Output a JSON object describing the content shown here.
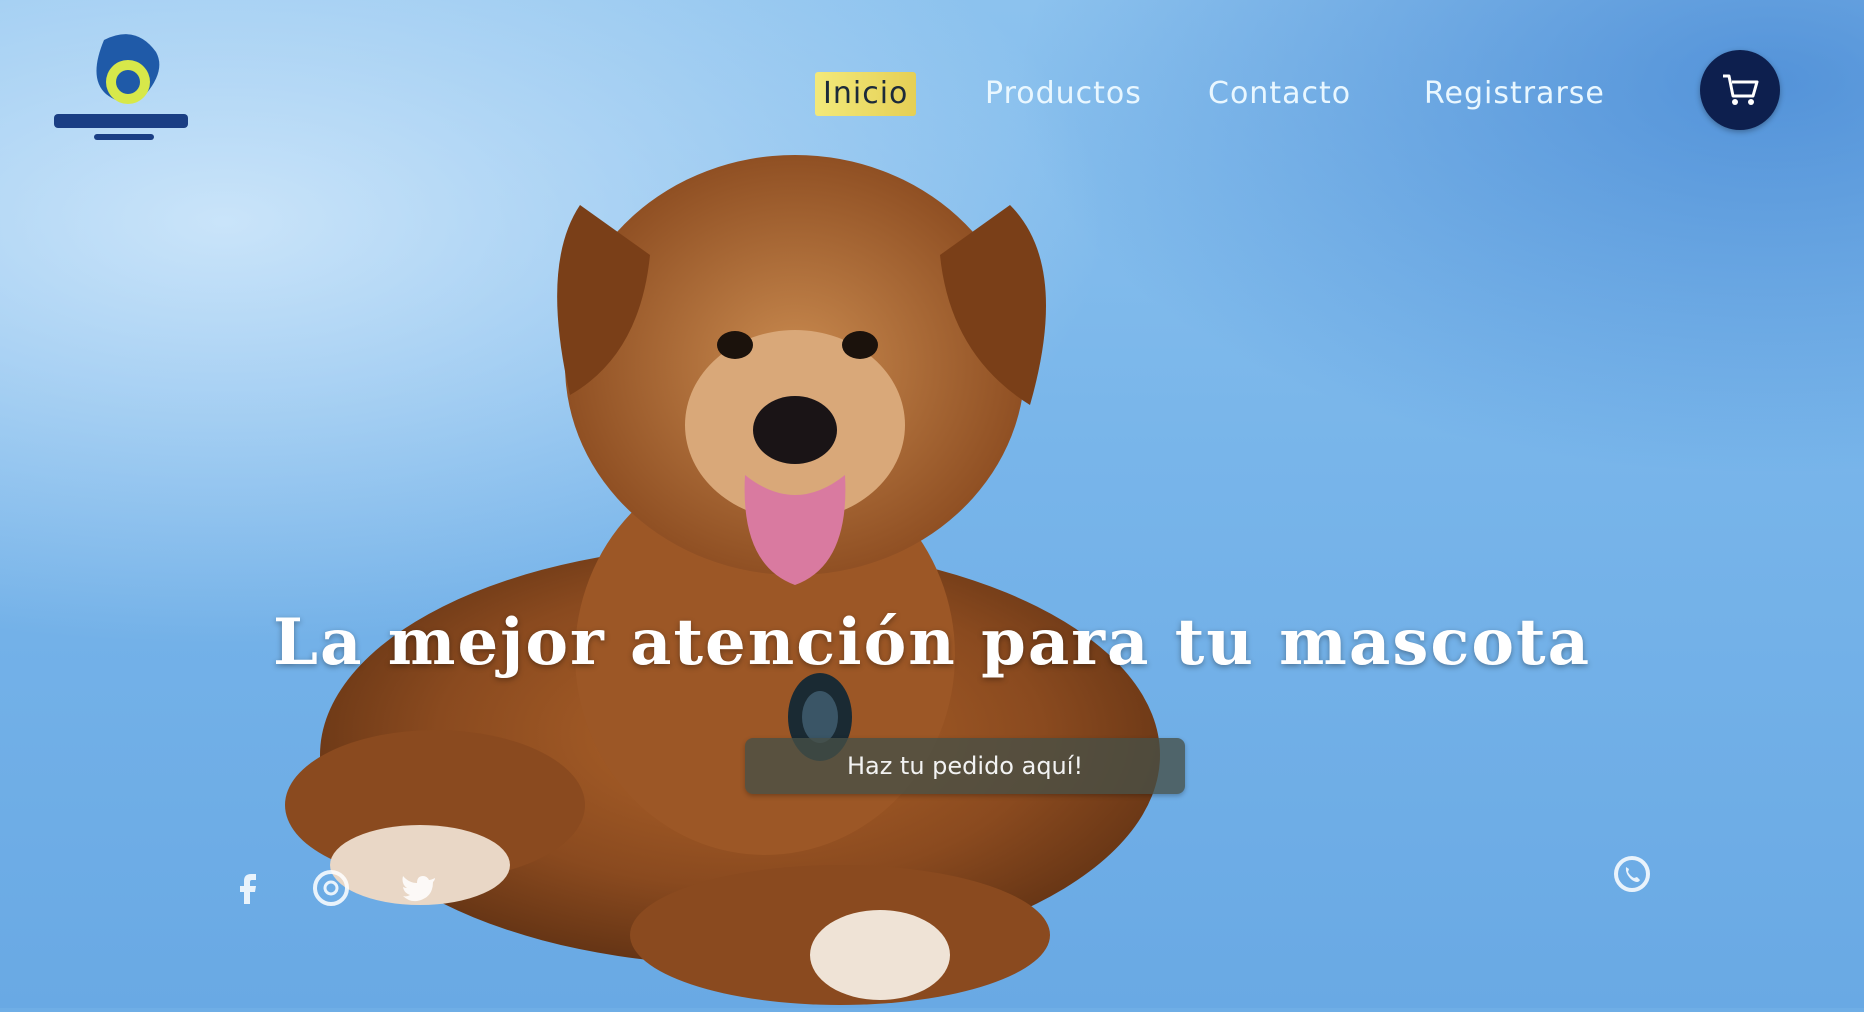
{
  "logo": {
    "name": "logo-icon"
  },
  "nav": {
    "home": "Inicio",
    "products": "Productos",
    "contact": "Contacto",
    "register": "Registrarse"
  },
  "cart": {
    "icon": "cart-icon"
  },
  "hero": {
    "headline": "La mejor atención para tu mascota",
    "cta": "Haz tu pedido aquí!"
  },
  "social": [
    "facebook-icon",
    "instagram-icon",
    "twitter-icon"
  ],
  "whatsapp": "whatsapp-icon",
  "colors": {
    "accent": "#f3e97a",
    "cartBg": "#0d1f4e",
    "heroBlue": "#78b5ea"
  }
}
